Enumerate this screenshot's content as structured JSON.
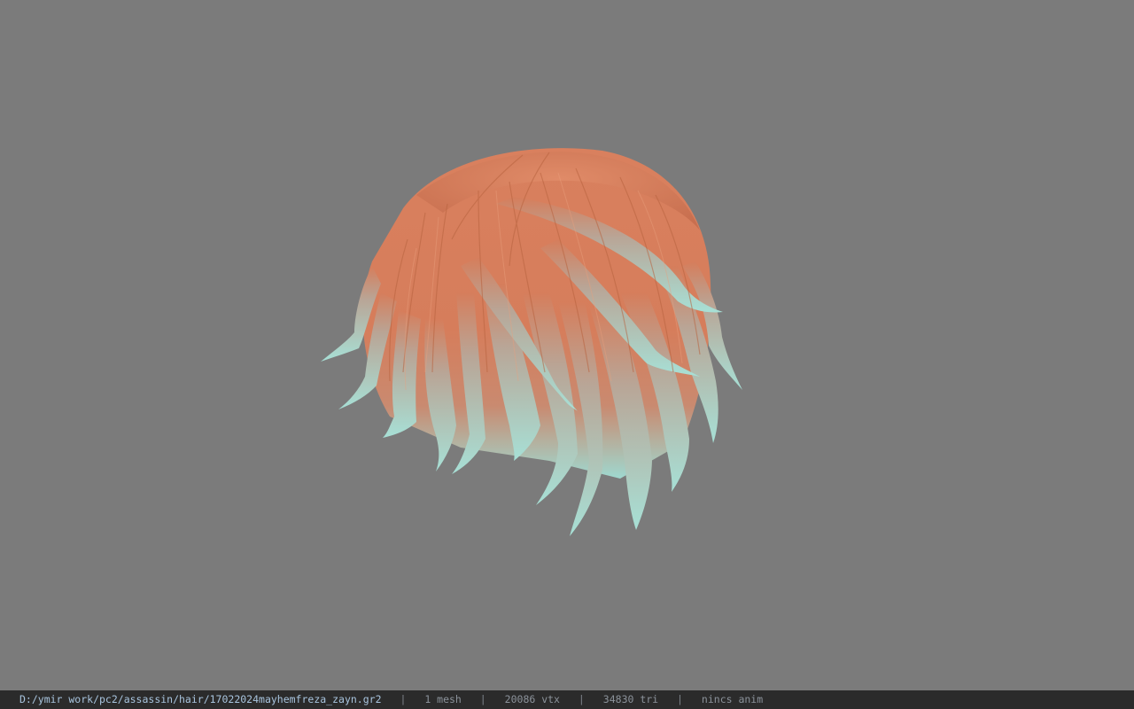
{
  "viewport": {
    "background_color": "#7b7b7b",
    "model": {
      "icon": "hair-mesh-model",
      "hair_color": "#d9805e",
      "tip_color": "#9fd8cf"
    }
  },
  "status_bar": {
    "file_path": "D:/ymir work/pc2/assassin/hair/17022024mayhemfreza_zayn.gr2",
    "separator": "|",
    "mesh_count": "1 mesh",
    "vertex_count": "20086 vtx",
    "triangle_count": "34830 tri",
    "animation": "nincs anim"
  }
}
